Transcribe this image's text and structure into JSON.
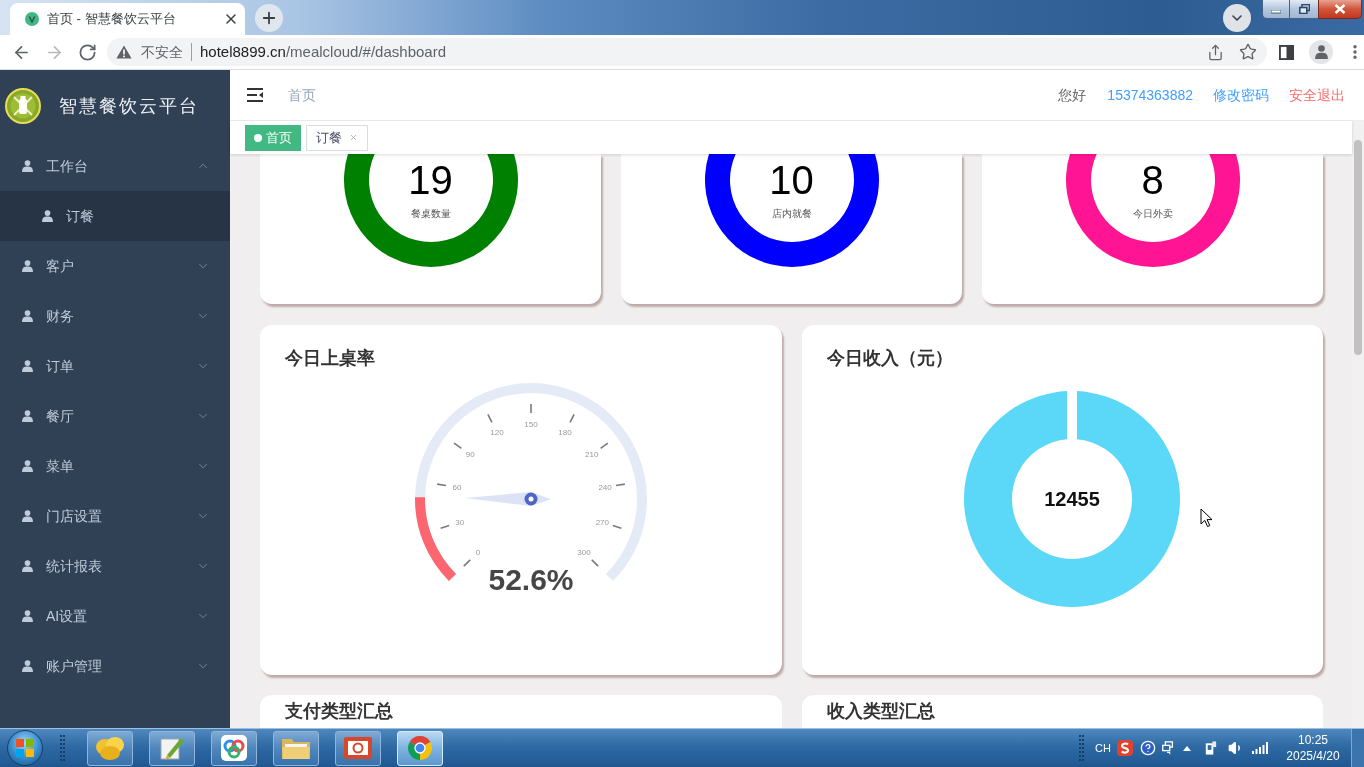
{
  "browser": {
    "tab": {
      "title": "首页 - 智慧餐饮云平台"
    },
    "nav_buttons": [
      {
        "kind": "back",
        "disabled": false
      },
      {
        "kind": "forward",
        "disabled": true
      },
      {
        "kind": "reload",
        "disabled": false
      }
    ],
    "address": {
      "security": "不安全",
      "host": "hotel8899.cn",
      "path": "/mealcloud/#/dashboard"
    }
  },
  "sidebar": {
    "brand": "智慧餐饮云平台",
    "menu": [
      {
        "label": "工作台",
        "expanded": true,
        "children": [
          {
            "label": "订餐"
          }
        ]
      },
      {
        "label": "客户",
        "expanded": false
      },
      {
        "label": "财务",
        "expanded": false
      },
      {
        "label": "订单",
        "expanded": false
      },
      {
        "label": "餐厅",
        "expanded": false
      },
      {
        "label": "菜单",
        "expanded": false
      },
      {
        "label": "门店设置",
        "expanded": false
      },
      {
        "label": "统计报表",
        "expanded": false
      },
      {
        "label": "AI设置",
        "expanded": false
      },
      {
        "label": "账户管理",
        "expanded": false
      }
    ]
  },
  "header": {
    "breadcrumb": "首页",
    "greeting": "您好",
    "user": "15374363882",
    "links": [
      {
        "label": "修改密码",
        "kind": "normal"
      },
      {
        "label": "安全退出",
        "kind": "danger"
      }
    ]
  },
  "tags": [
    {
      "label": "首页",
      "selected": true
    },
    {
      "label": "订餐",
      "selected": false
    }
  ],
  "stat_cards": [
    {
      "value": "19",
      "label": "餐桌数量",
      "color": "#008000"
    },
    {
      "value": "10",
      "label": "店内就餐",
      "color": "#0000ff"
    },
    {
      "value": "8",
      "label": "今日外卖",
      "color": "#ff1493"
    }
  ],
  "occupancy": {
    "title": "今日上桌率",
    "gauge": {
      "ticks": [
        "0",
        "30",
        "60",
        "90",
        "120",
        "150",
        "180",
        "210",
        "240",
        "270",
        "300"
      ],
      "level": 0.17,
      "reading": "52.6%"
    }
  },
  "income": {
    "title": "今日收入（元）",
    "total": "12455"
  },
  "summary_cards": [
    {
      "title": "支付类型汇总"
    },
    {
      "title": "收入类型汇总"
    }
  ],
  "taskbar": {
    "apps": [
      {
        "kind": "blob",
        "selected": false
      },
      {
        "kind": "pen",
        "selected": false
      },
      {
        "kind": "cloud",
        "selected": false
      },
      {
        "kind": "folder",
        "selected": false
      },
      {
        "kind": "slides",
        "selected": false
      },
      {
        "kind": "browser",
        "selected": true
      }
    ],
    "tray": {
      "language": "CH",
      "time": "10:25",
      "date": "2025/4/20"
    }
  }
}
